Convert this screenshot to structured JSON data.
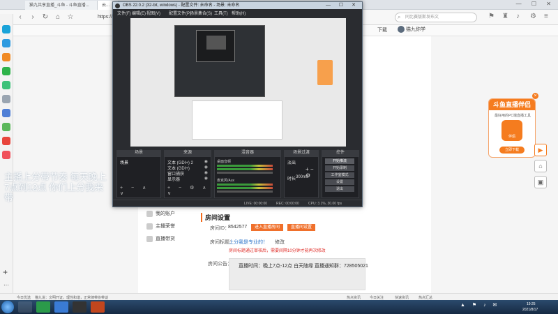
{
  "browser": {
    "tabs": [
      {
        "label": "猫九共享直播_斗鱼 - 斗鱼直播..."
      },
      {
        "label": "云..."
      }
    ],
    "url_text": "https://m...",
    "search_placeholder": "同比赛版斯发布文",
    "bookmarks": {
      "download": "下载",
      "user": "猫九你学"
    }
  },
  "obs": {
    "title": "OBS 22.0.2 (32-bit, windows) - 配置文件: 未命名 - 场景: 未命名",
    "menu": [
      "文件(F)",
      "编辑(E)",
      "视图(V)",
      "配置文件(P)",
      "场景集合(S)",
      "工具(T)",
      "帮助(H)"
    ],
    "docks": {
      "scenes": {
        "title": "场景",
        "items": [
          "场景"
        ]
      },
      "sources": {
        "title": "来源",
        "items": [
          "文本 (GDI+) 2",
          "文本 (GDI+)",
          "窗口捕获",
          "显示器"
        ]
      },
      "mixer": {
        "title": "混音器",
        "channels": [
          "桌面音频",
          "麦克风/Aux"
        ]
      },
      "transitions": {
        "title": "场景过渡",
        "type": "淡出",
        "duration_label": "时长",
        "duration": "300ms"
      },
      "controls": {
        "title": "控件",
        "buttons": [
          "开始推流",
          "开始录制",
          "工作室模式",
          "设置",
          "退出"
        ]
      }
    },
    "status": {
      "live": "LIVE: 00:00:00",
      "rec": "REC: 00:00:00",
      "cpu": "CPU: 3.1%, 30.00 fps"
    }
  },
  "page": {
    "nav": [
      "我的账户",
      "主播荣誉",
      "直播带货"
    ],
    "section_title": "房间设置",
    "room_id_label": "房间ID：",
    "room_id": "8542577",
    "btn_enter": "进入直播房间",
    "btn_settings": "直播间设置",
    "title_label": "房间标题：",
    "title_value": "上分我是专业的！",
    "title_edit": "修改",
    "title_warning": "房间标题通过审核后，需要间隔10分钟才能再次修改",
    "notice_label": "房间公告：",
    "notice_value": "直播时间：晚上7点-12点  白天随缘  直播通知群：728505021"
  },
  "ad": {
    "title": "斗鱼直播伴侣",
    "subtitle": "最好用的PC端直播工具",
    "logo_text": "伴侣",
    "button": "立即下载"
  },
  "overlay_text": "主播上分带节奏  每天晚上7点到12点  你们上分我来带",
  "statusbar": {
    "left": "今日优选",
    "mid": "猫九说：文明开证，理性和谐，正常律带协带谈",
    "items": [
      "热点资讯",
      "今日关注",
      "快速资讯",
      "热点汇总"
    ]
  },
  "clock": {
    "time": "19:25",
    "date": "2021/8/17"
  }
}
